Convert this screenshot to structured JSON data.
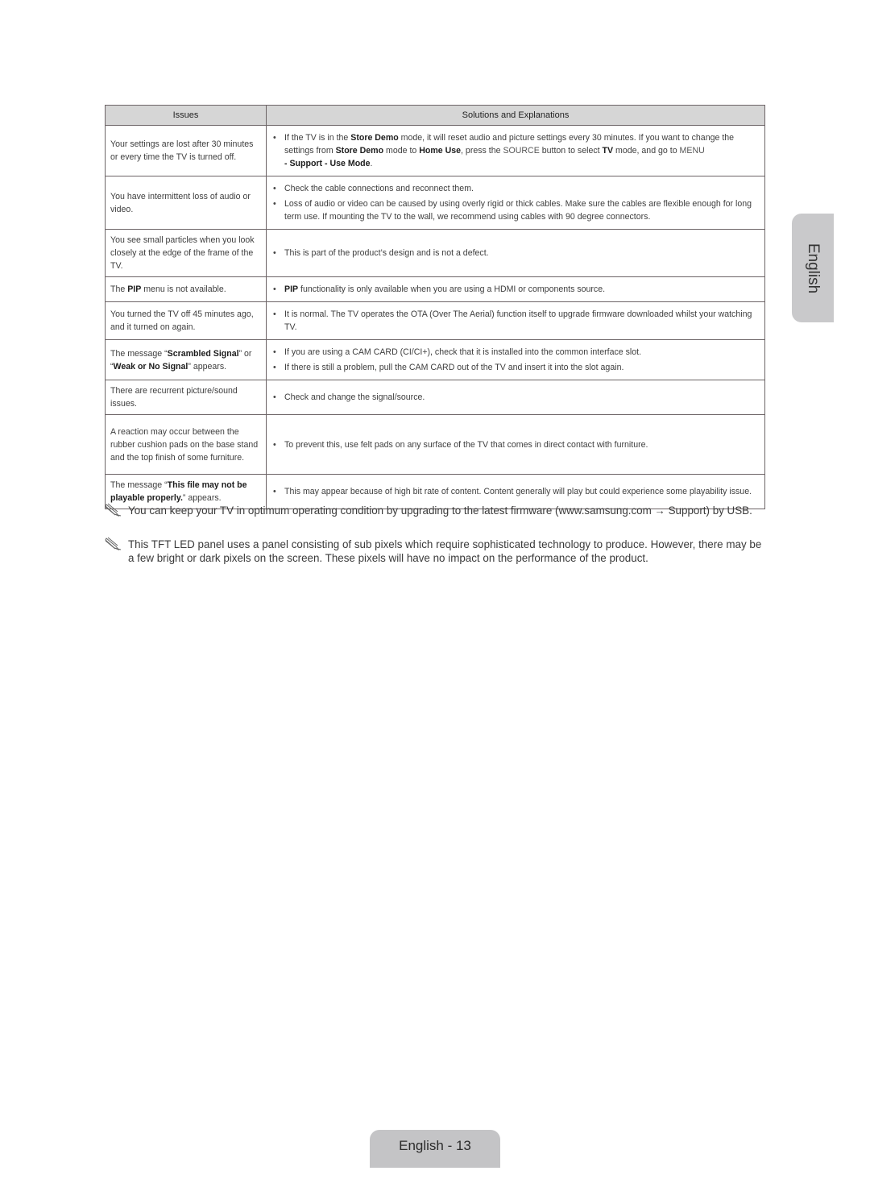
{
  "table": {
    "headers": {
      "issues": "Issues",
      "solutions": "Solutions and Explanations"
    },
    "rows": [
      {
        "issue": [
          {
            "t": "Your settings are lost after 30 minutes or every time the TV is turned off."
          }
        ],
        "solutions": [
          [
            {
              "t": "If the TV is in the "
            },
            {
              "t": "Store Demo",
              "style": "bold"
            },
            {
              "t": " mode, it will reset audio and picture settings every 30 minutes. If you want to change the settings from "
            },
            {
              "t": "Store Demo",
              "style": "bold"
            },
            {
              "t": " mode to "
            },
            {
              "t": "Home Use",
              "style": "bold"
            },
            {
              "t": ", press the "
            },
            {
              "t": "SOURCE",
              "style": "control"
            },
            {
              "t": " button to select "
            },
            {
              "t": "TV",
              "style": "bold"
            },
            {
              "t": " mode, and go to "
            },
            {
              "t": "MENU",
              "style": "control"
            },
            {
              "t": " - Support - Use Mode",
              "style": "bold",
              "newline": true
            },
            {
              "t": "."
            }
          ]
        ]
      },
      {
        "issue": [
          {
            "t": "You have intermittent loss of audio or video."
          }
        ],
        "solutions": [
          [
            {
              "t": "Check the cable connections and reconnect them."
            }
          ],
          [
            {
              "t": "Loss of audio or video can be caused by using overly rigid or thick cables. Make sure the cables are flexible enough for long term use. If mounting the TV to the wall, we recommend using cables with 90 degree connectors."
            }
          ]
        ]
      },
      {
        "issue": [
          {
            "t": "You see small particles when you look closely at the edge of the frame of the TV."
          }
        ],
        "solutions": [
          [
            {
              "t": "This is part of the product’s design and is not a defect."
            }
          ]
        ]
      },
      {
        "issue": [
          {
            "t": "The "
          },
          {
            "t": "PIP",
            "style": "bold"
          },
          {
            "t": " menu is not available."
          }
        ],
        "solutions": [
          [
            {
              "t": "PIP",
              "style": "bold"
            },
            {
              "t": " functionality is only available when you are using a HDMI or components source."
            }
          ]
        ]
      },
      {
        "issue": [
          {
            "t": "You turned the TV off 45 minutes ago, and it turned on again."
          }
        ],
        "solutions": [
          [
            {
              "t": "It is normal. The TV operates the OTA (Over The Aerial) function itself to upgrade firmware downloaded whilst your watching TV."
            }
          ]
        ]
      },
      {
        "issue": [
          {
            "t": "The message “"
          },
          {
            "t": "Scrambled Signal",
            "style": "bold"
          },
          {
            "t": "” or “"
          },
          {
            "t": "Weak or No Signal",
            "style": "bold"
          },
          {
            "t": "” appears."
          }
        ],
        "solutions": [
          [
            {
              "t": "If you are using a CAM CARD (CI/CI+), check that it is installed into the common interface slot."
            }
          ],
          [
            {
              "t": "If there is still a problem, pull the CAM CARD out of the TV and insert it into the slot again."
            }
          ]
        ]
      },
      {
        "issue": [
          {
            "t": "There are recurrent picture/sound issues."
          }
        ],
        "solutions": [
          [
            {
              "t": "Check and change the signal/source."
            }
          ]
        ]
      },
      {
        "issue": [
          {
            "t": "A reaction may occur between the rubber cushion pads on the base stand and the top finish of some furniture."
          }
        ],
        "solutions": [
          [
            {
              "t": "To prevent this, use felt pads on any surface of the TV that comes in direct contact with furniture."
            }
          ]
        ]
      },
      {
        "issue": [
          {
            "t": "The message “"
          },
          {
            "t": "This file may not be playable properly.",
            "style": "bold"
          },
          {
            "t": "” appears."
          }
        ],
        "solutions": [
          [
            {
              "t": "This may appear because of high bit rate of content. Content generally will play but could experience some playability issue."
            }
          ]
        ]
      }
    ]
  },
  "notes": [
    {
      "icon": "note-pencil-icon",
      "text": "You can keep your TV in optimum operating condition by upgrading to the latest firmware (www.samsung.com → Support) by USB."
    },
    {
      "icon": "note-pencil-icon",
      "text": "This TFT LED panel uses a panel consisting of sub pixels which require sophisticated technology to produce. However, there may be a few bright or dark pixels on the screen. These pixels will have no impact on the performance of the product."
    }
  ],
  "side_tab": {
    "label": "English"
  },
  "footer": {
    "page_label": "English - 13"
  }
}
